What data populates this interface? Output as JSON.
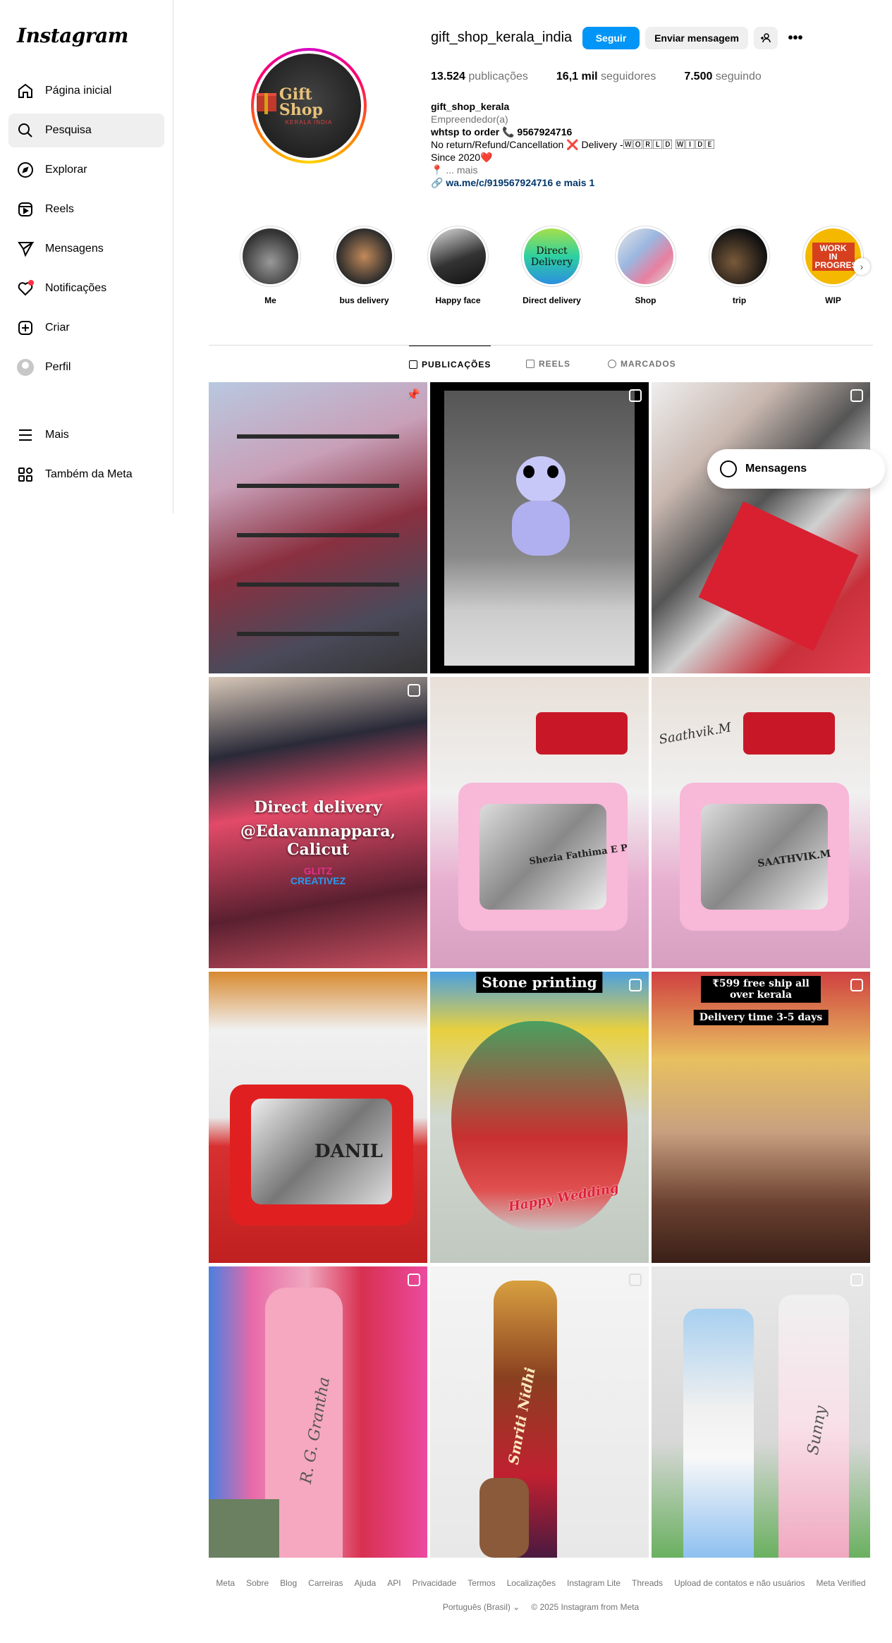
{
  "sidebar": {
    "logo": "Instagram",
    "items": [
      {
        "label": "Página inicial",
        "icon": "home-icon"
      },
      {
        "label": "Pesquisa",
        "icon": "search-icon"
      },
      {
        "label": "Explorar",
        "icon": "compass-icon"
      },
      {
        "label": "Reels",
        "icon": "reels-icon"
      },
      {
        "label": "Mensagens",
        "icon": "send-icon"
      },
      {
        "label": "Notificações",
        "icon": "heart-icon"
      },
      {
        "label": "Criar",
        "icon": "plus-square-icon"
      },
      {
        "label": "Perfil",
        "icon": "avatar-icon"
      },
      {
        "label": "Mais",
        "icon": "menu-icon"
      },
      {
        "label": "Também da Meta",
        "icon": "meta-apps-icon"
      }
    ]
  },
  "profile": {
    "username": "gift_shop_kerala_india",
    "follow_label": "Seguir",
    "message_label": "Enviar mensagem",
    "more_label": "•••",
    "logo_text": "Gift Shop",
    "logo_sub": "KERALA INDIA",
    "stats": {
      "posts_count": "13.524",
      "posts_label": "publicações",
      "followers_count": "16,1 mil",
      "followers_label": "seguidores",
      "following_count": "7.500",
      "following_label": "seguindo"
    },
    "bio": {
      "name": "gift_shop_kerala",
      "category": "Empreendedor(a)",
      "line1": "whtsp to order 📞 9567924716",
      "line2": "No return/Refund/Cancellation ❌ Delivery -🅆🄾🅁🄻🄳 🅆🄸🄳🄴",
      "line3": "Since 2020❤️",
      "line4": "📍 ... mais",
      "link": "🔗 wa.me/c/919567924716 e mais 1"
    }
  },
  "highlights": [
    {
      "label": "Me"
    },
    {
      "label": "bus delivery"
    },
    {
      "label": "Happy face"
    },
    {
      "label": "Direct delivery",
      "image_text": "Direct Delivery"
    },
    {
      "label": "Shop"
    },
    {
      "label": "trip"
    },
    {
      "label": "WIP",
      "image_text": "WORK IN PROGRESS"
    }
  ],
  "tabs": [
    {
      "label": "PUBLICAÇÕES"
    },
    {
      "label": "REELS"
    },
    {
      "label": "MARCADOS"
    }
  ],
  "posts": {
    "p4_text1": "Direct delivery",
    "p4_text2": "@Edavannappara, Calicut",
    "p4_brand1": "GLITZ",
    "p4_brand2": "CREATIVEZ",
    "p5_name": "Shezia Fathima E P",
    "p6_name": "SAATHVIK.M",
    "p6_bottle": "Saathvik.M",
    "p7_name": "DANIL",
    "p8_title": "Stone printing",
    "p8_sub": "Happy Wedding",
    "p9_line1": "₹599 free ship all over kerala",
    "p9_line2": "Delivery time 3-5 days",
    "p10_name": "R. G. Grantha",
    "p11_name": "Smriti Nidhi",
    "p12_name": "Sunny"
  },
  "floating_messages": "Mensagens",
  "footer": {
    "links": [
      "Meta",
      "Sobre",
      "Blog",
      "Carreiras",
      "Ajuda",
      "API",
      "Privacidade",
      "Termos",
      "Localizações",
      "Instagram Lite",
      "Threads",
      "Upload de contatos e não usuários",
      "Meta Verified"
    ],
    "language": "Português (Brasil) ⌄",
    "copyright": "© 2025 Instagram from Meta"
  }
}
